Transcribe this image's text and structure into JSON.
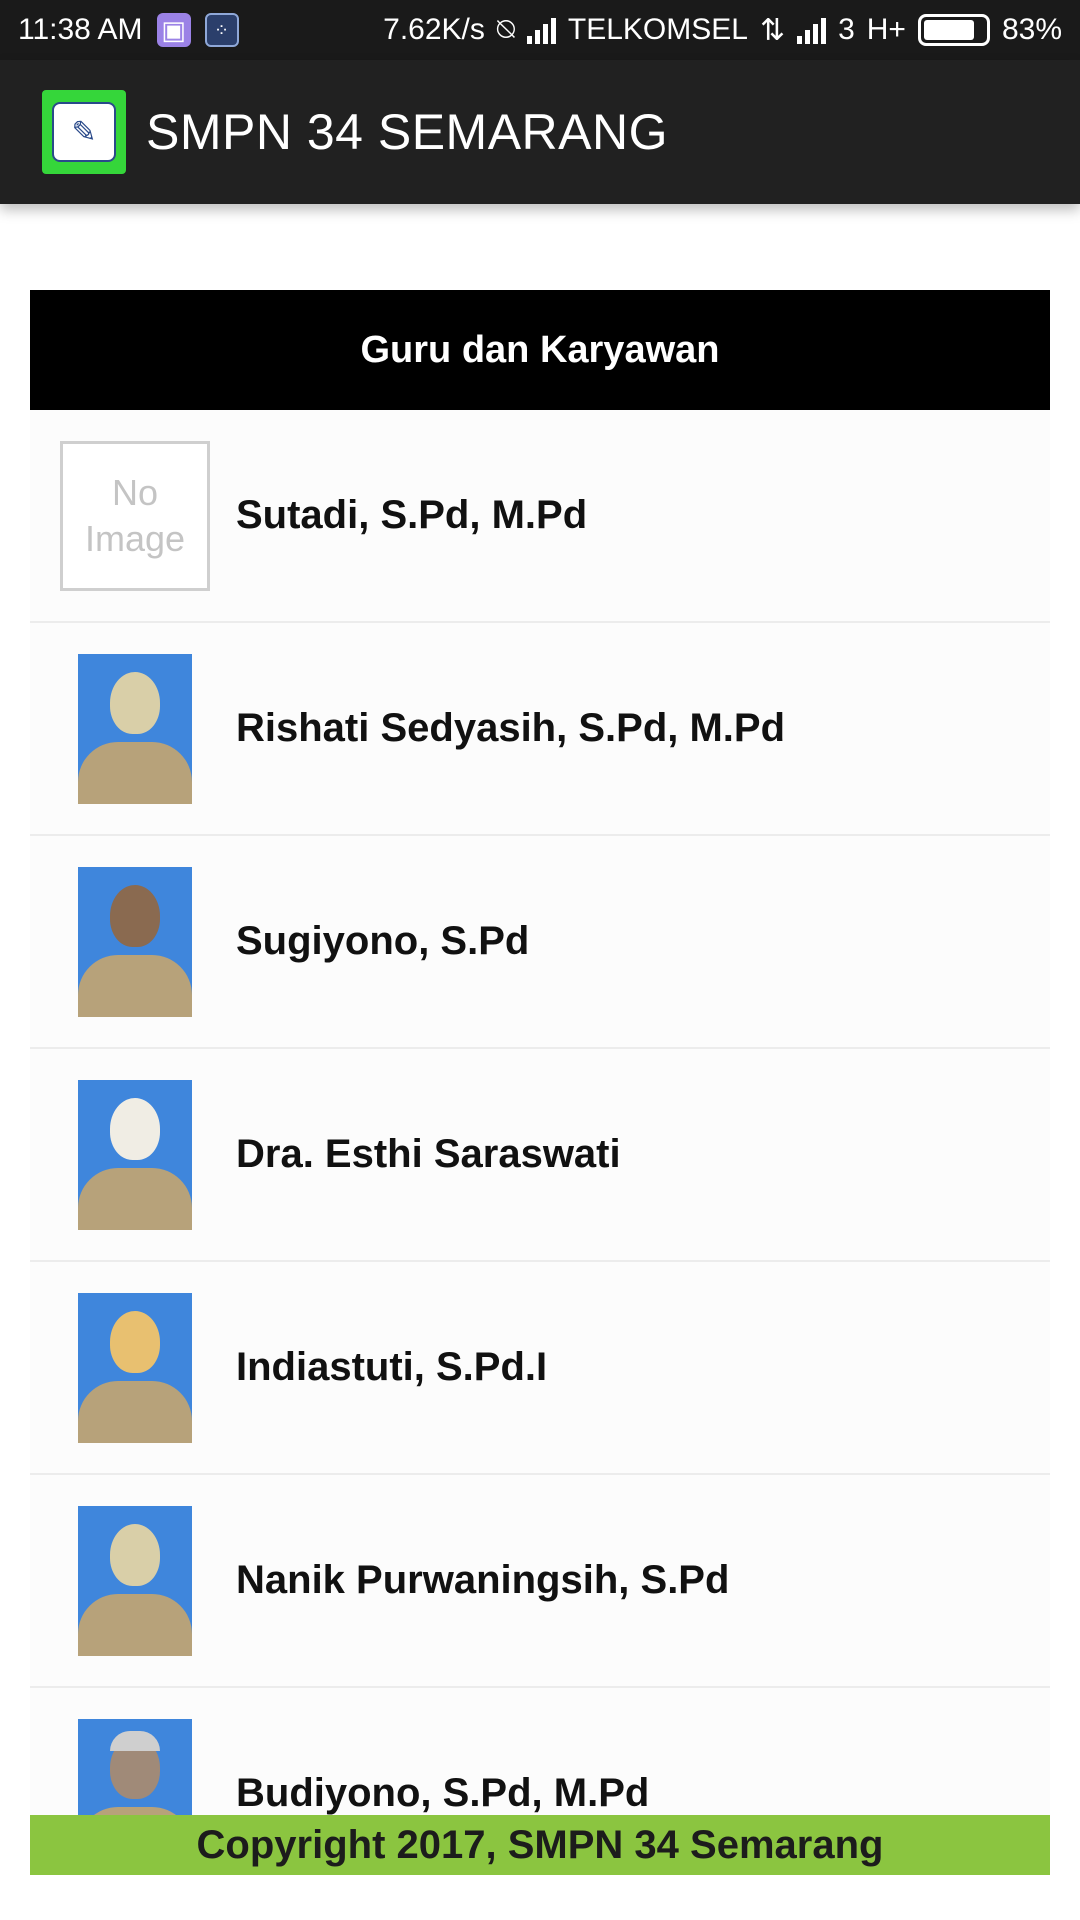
{
  "status_bar": {
    "time": "11:38 AM",
    "speed": "7.62K/s",
    "carrier": "TELKOMSEL",
    "sim2_network": "3",
    "network_type": "H+",
    "battery": "83%"
  },
  "app_bar": {
    "title": "SMPN 34 SEMARANG"
  },
  "section": {
    "title": "Guru dan Karyawan"
  },
  "no_image": {
    "line1": "No",
    "line2": "Image"
  },
  "staff": [
    {
      "name": "Sutadi, S.Pd, M.Pd",
      "photo": "no-image"
    },
    {
      "name": "Rishati Sedyasih, S.Pd, M.Pd",
      "photo": "hijab"
    },
    {
      "name": "Sugiyono, S.Pd",
      "photo": "man"
    },
    {
      "name": "Dra. Esthi Saraswati",
      "photo": "hijab-white"
    },
    {
      "name": "Indiastuti, S.Pd.I",
      "photo": "hijab-yellow"
    },
    {
      "name": "Nanik Purwaningsih, S.Pd",
      "photo": "hijab"
    },
    {
      "name": "Budiyono, S.Pd, M.Pd",
      "photo": "man-grey"
    }
  ],
  "footer": {
    "text": "Copyright 2017, SMPN 34 Semarang"
  },
  "colors": {
    "status_bar_bg": "#1a1a1a",
    "app_bar_bg": "#212121",
    "logo_green": "#35d63a",
    "section_header_bg": "#000000",
    "footer_bg": "#8bc540",
    "photo_bg": "#3f86dc"
  }
}
